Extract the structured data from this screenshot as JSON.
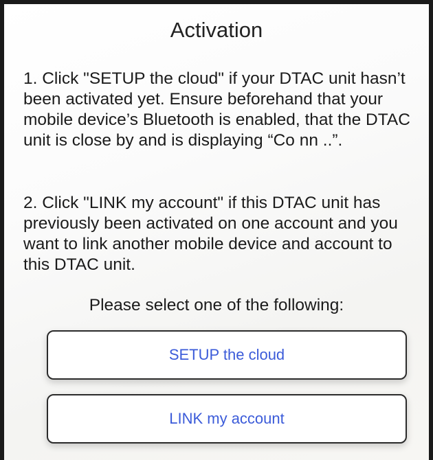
{
  "dialog": {
    "title": "Activation",
    "paragraph_1": "1. Click \"SETUP the cloud\" if your DTAC unit hasn’t been activated yet. Ensure beforehand that your mobile device’s Bluetooth is enabled, that the DTAC unit is close by and is displaying “Co nn ..”.",
    "paragraph_2": "2. Click \"LINK my account\" if this DTAC unit has previously been activated on one account and you want to link another mobile device and account to this DTAC unit.",
    "prompt": "Please select one of the following:",
    "setup_button_label": "SETUP the cloud",
    "link_button_label": "LINK my account"
  },
  "colors": {
    "button_text": "#3b5bd9",
    "frame_border": "#1a1a1a"
  }
}
